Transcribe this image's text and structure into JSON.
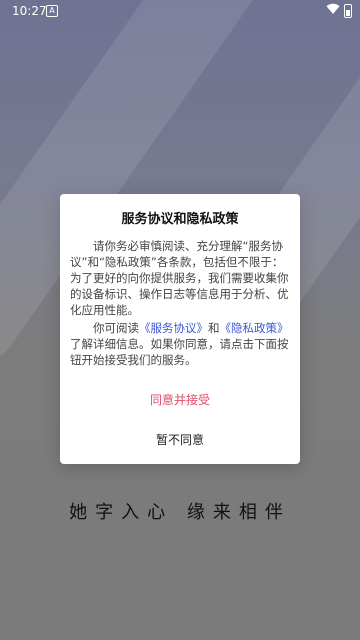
{
  "status_bar": {
    "time": "10:27",
    "a_icon": "A"
  },
  "dialog": {
    "title": "服务协议和隐私政策",
    "paragraph1": "请你务必审慎阅读、充分理解“服务协议”和“隐私政策”各条款，包括但不限于：为了更好的向你提供服务，我们需要收集你的设备标识、操作日志等信息用于分析、优化应用性能。",
    "p2_prefix": "你可阅读",
    "link_service": "《服务协议》",
    "p2_and": "和",
    "link_privacy": "《隐私政策》",
    "p2_suffix": "了解详细信息。如果你同意，请点击下面按钮开始接受我们的服务。",
    "agree_button": "同意并接受",
    "disagree_button": "暂不同意"
  },
  "background": {
    "slogan": "她字入心  缘来相伴"
  },
  "colors": {
    "link": "#3b57d9",
    "agree": "#e34b63"
  }
}
